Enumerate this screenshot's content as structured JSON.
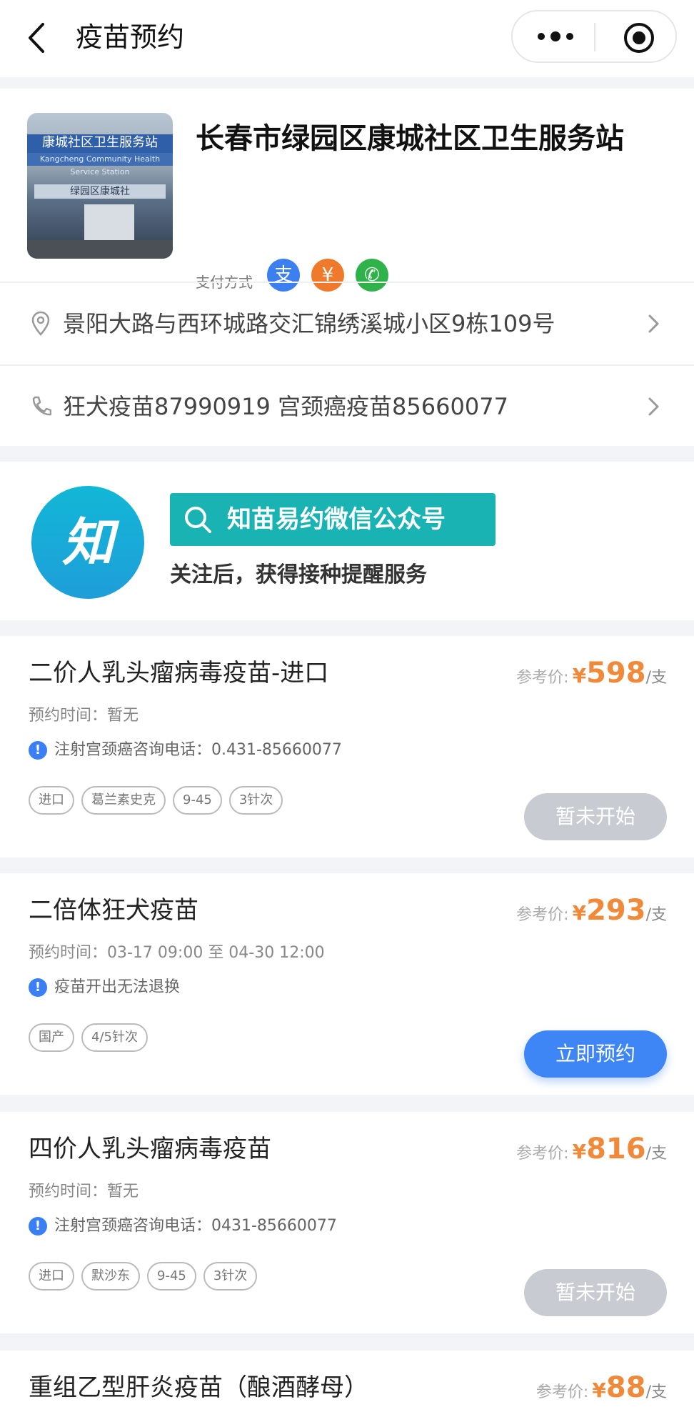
{
  "navbar": {
    "title": "疫苗预约"
  },
  "station": {
    "name": "长春市绿园区康城社区卫生服务站",
    "photo_sign": "康城社区卫生服务站",
    "photo_sign_en": "Kangcheng Community Health Service Station",
    "photo_band": "绿园区康城社",
    "pay_label": "支付方式",
    "pay_methods": [
      {
        "name": "alipay",
        "glyph": "支",
        "color": "#3b7ff0"
      },
      {
        "name": "cash",
        "glyph": "¥",
        "color": "#f07a2c"
      },
      {
        "name": "wechat",
        "glyph": "✆",
        "color": "#2fb24a"
      }
    ],
    "address": "景阳大路与西环城路交汇锦绣溪城小区9栋109号",
    "phone": "狂犬疫苗87990919 宫颈癌疫苗85660077"
  },
  "promo": {
    "logo_text": "知",
    "banner_text": "知苗易约微信公众号",
    "desc": "关注后，获得接种提醒服务"
  },
  "vaccines": [
    {
      "name": "二价人乳头瘤病毒疫苗-进口",
      "price_label": "参考价:",
      "currency": "¥",
      "price": "598",
      "unit": "/支",
      "time": "预约时间：暂无",
      "note": "注射宫颈癌咨询电话：0.431-85660077",
      "tags": [
        "进口",
        "葛兰素史克",
        "9-45",
        "3针次"
      ],
      "button": "暂未开始",
      "button_state": "disabled"
    },
    {
      "name": "二倍体狂犬疫苗",
      "price_label": "参考价:",
      "currency": "¥",
      "price": "293",
      "unit": "/支",
      "time": "预约时间：03-17 09:00 至 04-30 12:00",
      "note": "疫苗开出无法退换",
      "tags": [
        "国产",
        "4/5针次"
      ],
      "button": "立即预约",
      "button_state": "enabled"
    },
    {
      "name": "四价人乳头瘤病毒疫苗",
      "price_label": "参考价:",
      "currency": "¥",
      "price": "816",
      "unit": "/支",
      "time": "预约时间：暂无",
      "note": "注射宫颈癌咨询电话：0431-85660077",
      "tags": [
        "进口",
        "默沙东",
        "9-45",
        "3针次"
      ],
      "button": "暂未开始",
      "button_state": "disabled"
    },
    {
      "name": "重组乙型肝炎疫苗（酿酒酵母）",
      "price_label": "参考价:",
      "currency": "¥",
      "price": "88",
      "unit": "/支"
    }
  ]
}
